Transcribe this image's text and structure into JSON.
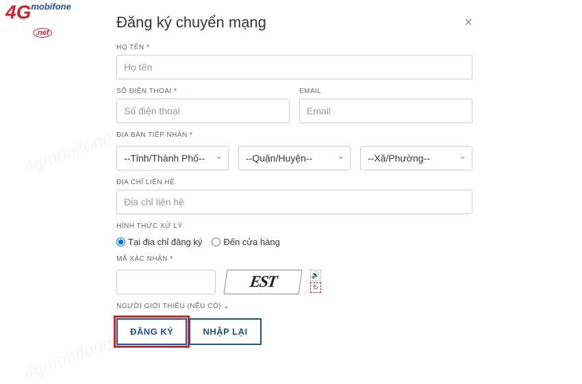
{
  "logo": {
    "g4": "4G",
    "mobi": "mobifone",
    "net": ".net"
  },
  "watermark": "4gmobifone.net",
  "modal": {
    "title": "Đăng ký chuyển mạng",
    "close": "×",
    "fields": {
      "fullname": {
        "label": "HỌ TÊN",
        "placeholder": "Họ tên"
      },
      "phone": {
        "label": "SỐ ĐIỆN THOẠI",
        "placeholder": "Số điện thoại"
      },
      "email": {
        "label": "EMAIL",
        "placeholder": "Email"
      },
      "region": {
        "label": "ĐỊA BÀN TIẾP NHẬN",
        "province": "--Tỉnh/Thành Phố--",
        "district": "--Quận/Huyện--",
        "ward": "--Xã/Phường--"
      },
      "address": {
        "label": "ĐỊA CHỈ LIÊN HỆ",
        "placeholder": "Địa chỉ liên hệ"
      },
      "processing": {
        "label": "HÌNH THỨC XỬ LÝ",
        "at_address": "Tại địa chỉ đăng ký",
        "at_store": "Đến cửa hàng"
      },
      "captcha": {
        "label": "MÃ XÁC NHẬN",
        "image_text": "EST"
      },
      "referrer": {
        "label": "NGƯỜI GIỚI THIỆU (NẾU CÓ)",
        "chevron": "⌄"
      }
    },
    "buttons": {
      "submit": "ĐĂNG KÝ",
      "reset": "NHẬP LẠI"
    }
  }
}
